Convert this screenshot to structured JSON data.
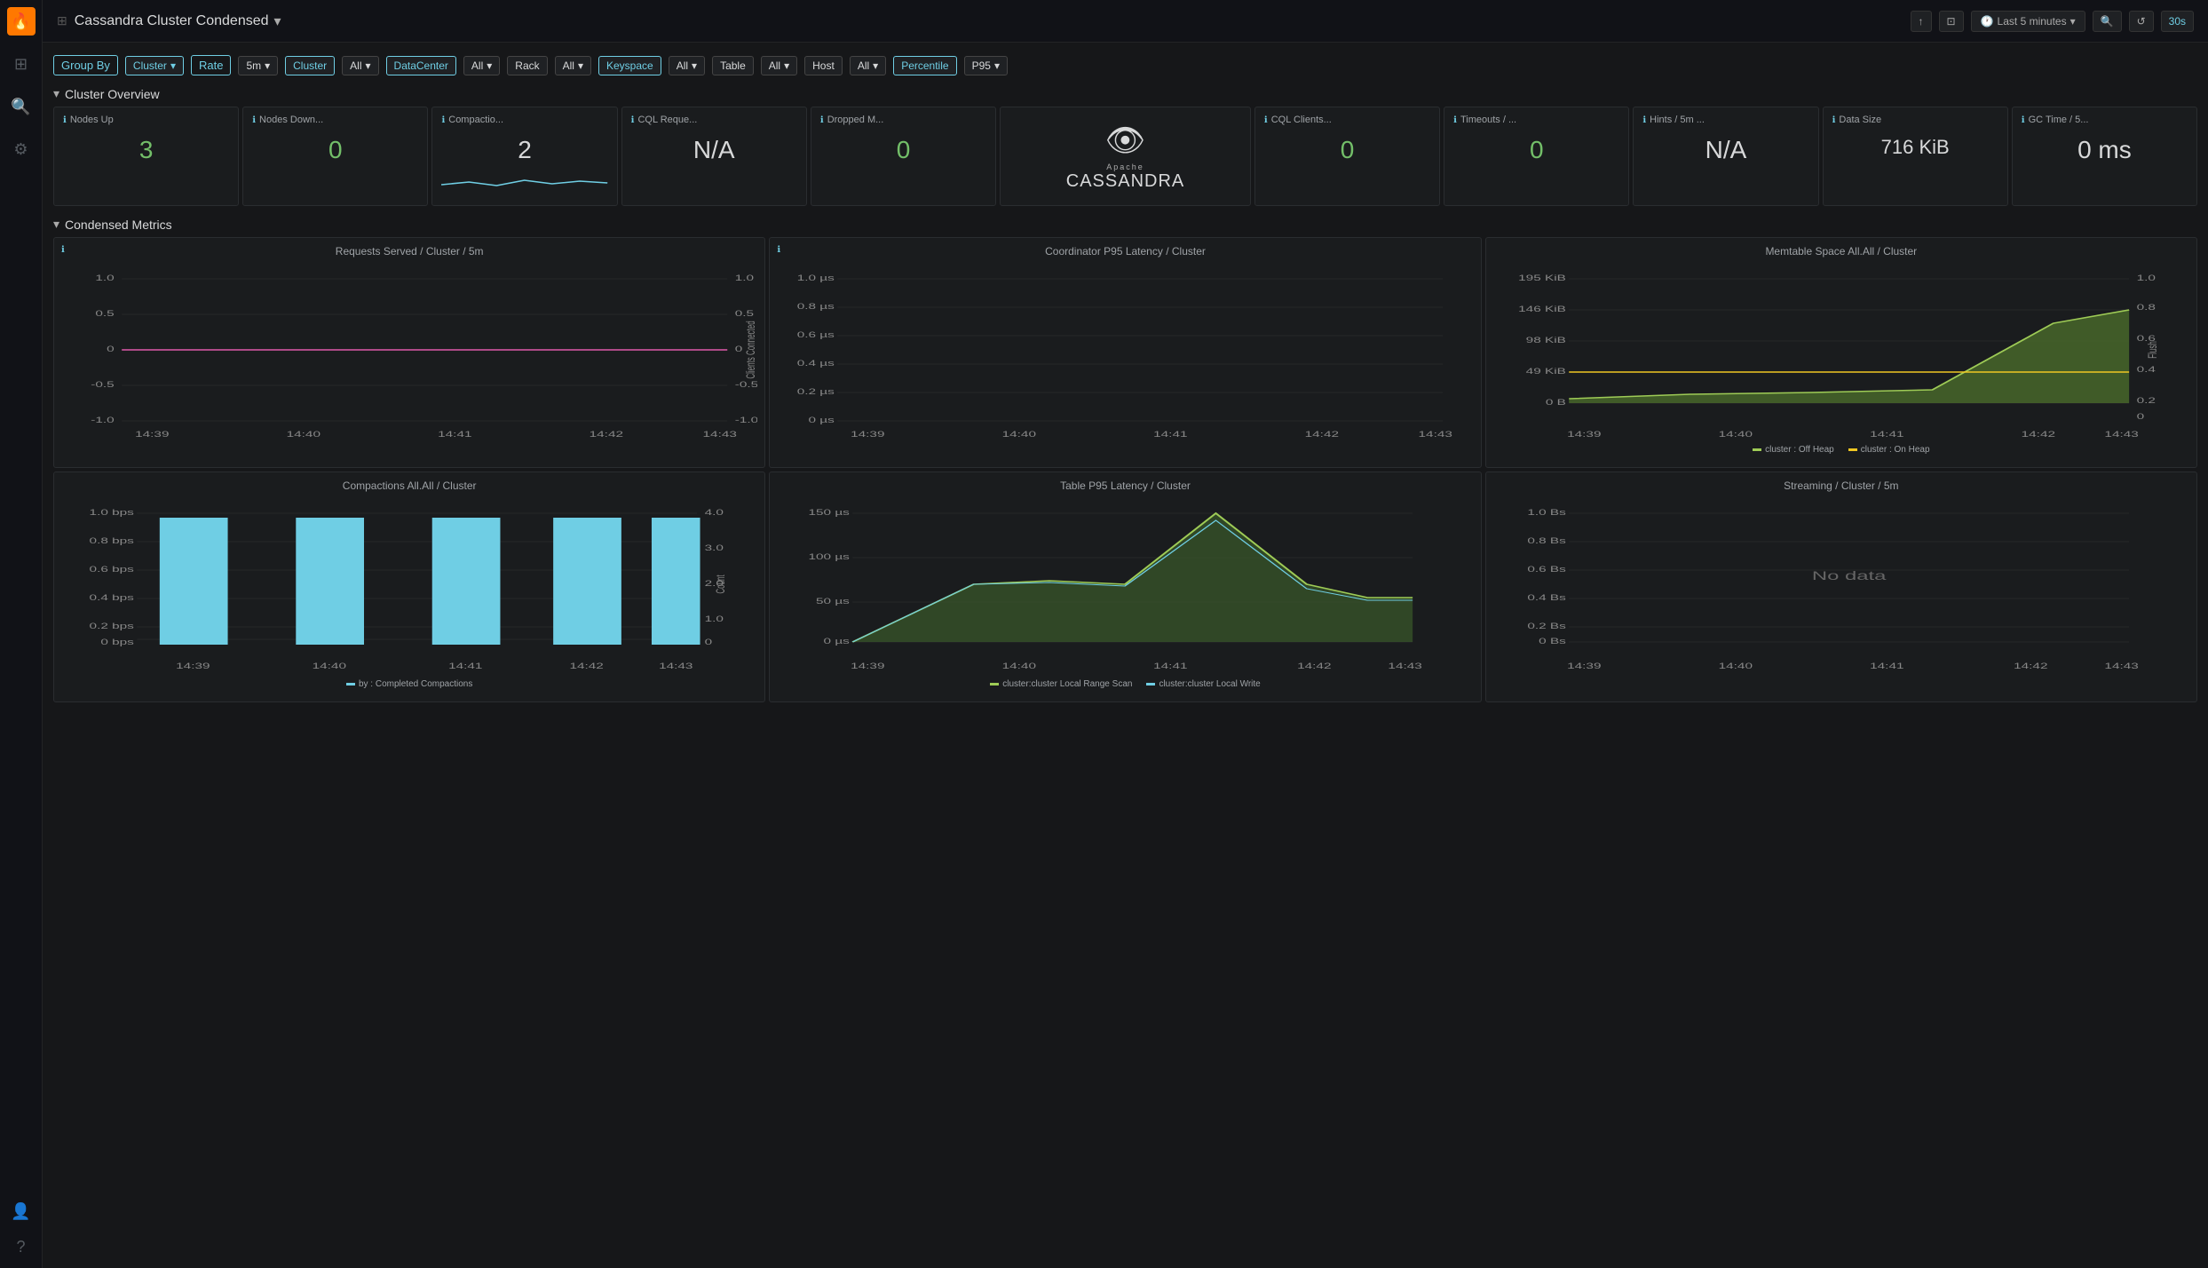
{
  "app": {
    "logo": "🔥",
    "title": "Cassandra Cluster Condensed",
    "title_arrow": "▾"
  },
  "topbar": {
    "share_label": "↑",
    "tv_label": "⊡",
    "time_label": "Last 5 minutes",
    "search_label": "🔍",
    "refresh_label": "↺",
    "interval_label": "30s"
  },
  "filters": [
    {
      "key": "groupby",
      "label": "Group By",
      "value": "Cluster",
      "teal": true
    },
    {
      "key": "rate",
      "label": "Rate",
      "value": "5m",
      "teal": false
    },
    {
      "key": "cluster",
      "label": "Cluster",
      "value": "All",
      "teal": true
    },
    {
      "key": "datacenter",
      "label": "DataCenter",
      "value": "All",
      "teal": true
    },
    {
      "key": "rack",
      "label": "Rack",
      "value": "All",
      "teal": false
    },
    {
      "key": "keyspace",
      "label": "Keyspace",
      "value": "All",
      "teal": false
    },
    {
      "key": "table",
      "label": "Table",
      "value": "All",
      "teal": false
    },
    {
      "key": "host",
      "label": "Host",
      "value": "All",
      "teal": false
    },
    {
      "key": "percentile",
      "label": "Percentile",
      "value": "P95",
      "teal": true
    }
  ],
  "cluster_overview": {
    "title": "Cluster Overview",
    "cards": [
      {
        "id": "nodes-up",
        "title": "Nodes Up",
        "value": "3",
        "color": "green",
        "has_sparkline": false
      },
      {
        "id": "nodes-down",
        "title": "Nodes Down...",
        "value": "0",
        "color": "green",
        "has_sparkline": false
      },
      {
        "id": "compaction",
        "title": "Compactio...",
        "value": "2",
        "color": "white",
        "has_sparkline": true
      },
      {
        "id": "cql-requests",
        "title": "CQL Reque...",
        "value": "N/A",
        "color": "white",
        "has_sparkline": false
      },
      {
        "id": "dropped-m",
        "title": "Dropped M...",
        "value": "0",
        "color": "green",
        "has_sparkline": false
      },
      {
        "id": "logo",
        "type": "logo"
      },
      {
        "id": "cql-clients",
        "title": "CQL Clients...",
        "value": "0",
        "color": "green",
        "has_sparkline": false
      },
      {
        "id": "timeouts",
        "title": "Timeouts / ...",
        "value": "0",
        "color": "green",
        "has_sparkline": false
      },
      {
        "id": "hints",
        "title": "Hints / 5m ...",
        "value": "N/A",
        "color": "white",
        "has_sparkline": false
      },
      {
        "id": "data-size",
        "title": "Data Size",
        "value": "716 KiB",
        "color": "white",
        "has_sparkline": false
      },
      {
        "id": "gc-time",
        "title": "GC Time / 5...",
        "value": "0 ms",
        "color": "white",
        "has_sparkline": false
      }
    ]
  },
  "condensed_metrics": {
    "title": "Condensed Metrics",
    "charts": [
      {
        "id": "requests-served",
        "title": "Requests Served / Cluster / 5m",
        "type": "line",
        "has_info": true,
        "yaxis": [
          "-1.0",
          "-0.5",
          "0",
          "0.5",
          "1.0"
        ],
        "yaxis_right": [
          "-1.0",
          "-0.5",
          "0",
          "0.5",
          "1.0"
        ],
        "yaxis_right_label": "Clients Connected",
        "xaxis": [
          "14:39",
          "14:40",
          "14:41",
          "14:42",
          "14:43"
        ]
      },
      {
        "id": "coordinator-latency",
        "title": "Coordinator P95 Latency / Cluster",
        "type": "line",
        "has_info": true,
        "yaxis": [
          "0 µs",
          "0.2 µs",
          "0.4 µs",
          "0.6 µs",
          "0.8 µs",
          "1.0 µs"
        ],
        "xaxis": [
          "14:39",
          "14:40",
          "14:41",
          "14:42",
          "14:43"
        ]
      },
      {
        "id": "memtable-space",
        "title": "Memtable Space All.All / Cluster",
        "type": "area",
        "has_info": false,
        "yaxis": [
          "0 B",
          "49 KiB",
          "98 KiB",
          "146 KiB",
          "195 KiB"
        ],
        "yaxis_right": [
          "0",
          "0.2",
          "0.4",
          "0.6",
          "0.8",
          "1.0"
        ],
        "yaxis_right_label": "Flush",
        "xaxis": [
          "14:39",
          "14:40",
          "14:41",
          "14:42",
          "14:43"
        ],
        "legend": [
          {
            "label": "cluster : Off Heap",
            "color": "#9ecb56"
          },
          {
            "label": "cluster : On Heap",
            "color": "#f0c722"
          }
        ]
      },
      {
        "id": "compactions",
        "title": "Compactions All.All / Cluster",
        "type": "bar",
        "has_info": false,
        "yaxis": [
          "0 bps",
          "0.2 bps",
          "0.4 bps",
          "0.6 bps",
          "0.8 bps",
          "1.0 bps"
        ],
        "yaxis_right": [
          "0",
          "1.0",
          "2.0",
          "3.0",
          "4.0"
        ],
        "yaxis_right_label": "Count",
        "xaxis": [
          "14:39",
          "14:40",
          "14:41",
          "14:42",
          "14:43"
        ],
        "legend": [
          {
            "label": "by : Completed Compactions",
            "color": "#6fcee4"
          }
        ]
      },
      {
        "id": "table-latency",
        "title": "Table P95 Latency / Cluster",
        "type": "area_line",
        "has_info": false,
        "yaxis": [
          "0 µs",
          "50 µs",
          "100 µs",
          "150 µs"
        ],
        "xaxis": [
          "14:39",
          "14:40",
          "14:41",
          "14:42",
          "14:43"
        ],
        "legend": [
          {
            "label": "cluster:cluster Local Range Scan",
            "color": "#9ecb56"
          },
          {
            "label": "cluster:cluster Local Write",
            "color": "#6fcee4"
          }
        ]
      },
      {
        "id": "streaming",
        "title": "Streaming / Cluster / 5m",
        "type": "nodata",
        "has_info": false,
        "yaxis": [
          "0 Bs",
          "0.2 Bs",
          "0.4 Bs",
          "0.6 Bs",
          "0.8 Bs",
          "1.0 Bs"
        ],
        "xaxis": [
          "14:39",
          "14:40",
          "14:41",
          "14:42",
          "14:43"
        ],
        "nodata_text": "No data"
      }
    ]
  }
}
